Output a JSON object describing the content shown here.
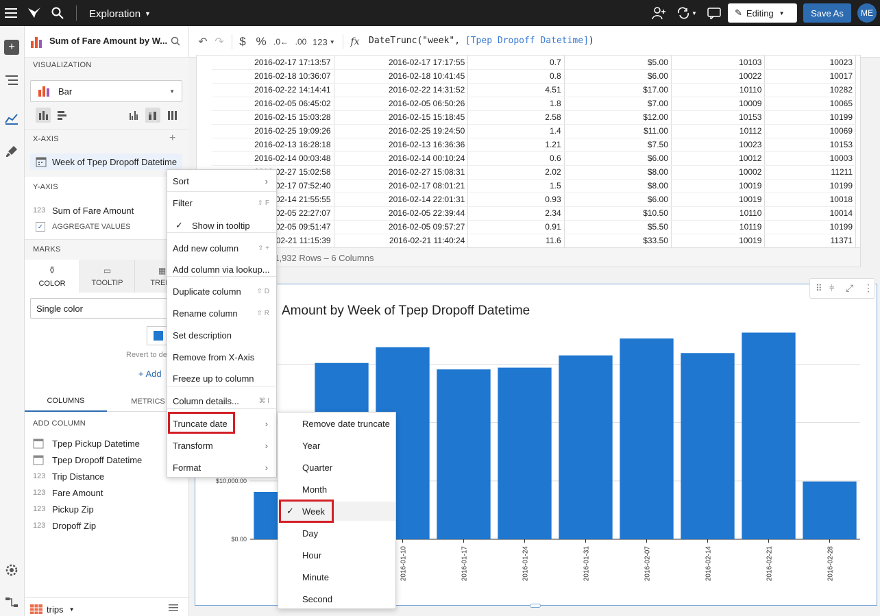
{
  "topbar": {
    "workbook_title": "Exploration",
    "editing_label": "Editing",
    "save_as_label": "Save As",
    "avatar_initials": "ME"
  },
  "panel": {
    "element_title": "Sum of Fare Amount by W...",
    "visualization_label": "VISUALIZATION",
    "chart_type": "Bar",
    "x_axis_label": "X-AXIS",
    "x_axis_field": "Week of Tpep Dropoff Datetime",
    "y_axis_label": "Y-AXIS",
    "y_axis_field_type": "123",
    "y_axis_field": "Sum of Fare Amount",
    "aggregate_label": "AGGREGATE VALUES",
    "marks_label": "MARKS",
    "marks_tabs": [
      "COLOR",
      "TOOLTIP",
      "TRELL"
    ],
    "color_mode": "Single color",
    "revert_label": "Revert to de",
    "add_label": "+ Add",
    "tabs": [
      "COLUMNS",
      "METRICS"
    ],
    "add_column_label": "ADD COLUMN",
    "columns": [
      {
        "type": "date",
        "name": "Tpep Pickup Datetime"
      },
      {
        "type": "date",
        "name": "Tpep Dropoff Datetime"
      },
      {
        "type": "123",
        "name": "Trip Distance"
      },
      {
        "type": "123",
        "name": "Fare Amount"
      },
      {
        "type": "123",
        "name": "Pickup Zip"
      },
      {
        "type": "123",
        "name": "Dropoff Zip"
      }
    ],
    "source_name": "trips"
  },
  "toolbar": {
    "format_dollar": "$",
    "format_percent": "%",
    "format_number": "123",
    "formula_prefix": "DateTrunc(\"week\", ",
    "formula_ref": "[Tpep Dropoff Datetime]",
    "formula_suffix": ")"
  },
  "table": {
    "rows": [
      [
        "2016-02-17 17:13:57",
        "2016-02-17 17:17:55",
        "0.7",
        "$5.00",
        "10103",
        "10023"
      ],
      [
        "2016-02-18 10:36:07",
        "2016-02-18 10:41:45",
        "0.8",
        "$6.00",
        "10022",
        "10017"
      ],
      [
        "2016-02-22 14:14:41",
        "2016-02-22 14:31:52",
        "4.51",
        "$17.00",
        "10110",
        "10282"
      ],
      [
        "2016-02-05 06:45:02",
        "2016-02-05 06:50:26",
        "1.8",
        "$7.00",
        "10009",
        "10065"
      ],
      [
        "2016-02-15 15:03:28",
        "2016-02-15 15:18:45",
        "2.58",
        "$12.00",
        "10153",
        "10199"
      ],
      [
        "2016-02-25 19:09:26",
        "2016-02-25 19:24:50",
        "1.4",
        "$11.00",
        "10112",
        "10069"
      ],
      [
        "2016-02-13 16:28:18",
        "2016-02-13 16:36:36",
        "1.21",
        "$7.50",
        "10023",
        "10153"
      ],
      [
        "2016-02-14 00:03:48",
        "2016-02-14 00:10:24",
        "0.6",
        "$6.00",
        "10012",
        "10003"
      ],
      [
        "2016-02-27 15:02:58",
        "2016-02-27 15:08:31",
        "2.02",
        "$8.00",
        "10002",
        "11211"
      ],
      [
        "2016-02-17 07:52:40",
        "2016-02-17 08:01:21",
        "1.5",
        "$8.00",
        "10019",
        "10199"
      ],
      [
        "2016-02-14 21:55:55",
        "2016-02-14 22:01:31",
        "0.93",
        "$6.00",
        "10019",
        "10018"
      ],
      [
        "2016-02-05 22:27:07",
        "2016-02-05 22:39:44",
        "2.34",
        "$10.50",
        "10110",
        "10014"
      ],
      [
        "2016-02-05 09:51:47",
        "2016-02-05 09:57:27",
        "0.91",
        "$5.50",
        "10119",
        "10199"
      ],
      [
        "2016-02-21 11:15:39",
        "2016-02-21 11:40:24",
        "11.6",
        "$33.50",
        "10019",
        "11371"
      ]
    ],
    "footer": "21,932 Rows – 6 Columns"
  },
  "context_menu": {
    "items": [
      {
        "label": "Sort",
        "shortcut": "",
        "submenu": true
      },
      {
        "label": "Filter",
        "shortcut": "⇧ F",
        "submenu": false
      },
      {
        "label": "Show in tooltip",
        "shortcut": "",
        "submenu": false,
        "checked": true
      },
      {
        "label": "Add new column",
        "shortcut": "⇧ +",
        "submenu": false
      },
      {
        "label": "Add column via lookup...",
        "shortcut": "",
        "submenu": false
      },
      {
        "label": "Duplicate column",
        "shortcut": "⇧ D",
        "submenu": false
      },
      {
        "label": "Rename column",
        "shortcut": "⇧ R",
        "submenu": false
      },
      {
        "label": "Set description",
        "shortcut": "",
        "submenu": false
      },
      {
        "label": "Remove from X-Axis",
        "shortcut": "",
        "submenu": false
      },
      {
        "label": "Freeze up to column",
        "shortcut": "",
        "submenu": false
      },
      {
        "label": "Column details...",
        "shortcut": "⌘ I",
        "submenu": false
      },
      {
        "label": "Truncate date",
        "shortcut": "",
        "submenu": true
      },
      {
        "label": "Transform",
        "shortcut": "",
        "submenu": true
      },
      {
        "label": "Format",
        "shortcut": "",
        "submenu": true
      }
    ]
  },
  "submenu": {
    "items": [
      "Remove date truncate",
      "Year",
      "Quarter",
      "Month",
      "Week",
      "Day",
      "Hour",
      "Minute",
      "Second"
    ],
    "checked": "Week"
  },
  "chart_data": {
    "type": "bar",
    "title": "Amount by Week of Tpep Dropoff Datetime",
    "categories": [
      "",
      "",
      "2016-01-10",
      "2016-01-17",
      "2016-01-24",
      "2016-01-31",
      "2016-02-07",
      "2016-02-14",
      "2016-02-21",
      "2016-02-28"
    ],
    "values": [
      8100,
      30200,
      32900,
      29100,
      29400,
      31500,
      34400,
      31900,
      35400,
      9900
    ],
    "y_ticks": [
      {
        "value": 0,
        "label": "$0.00"
      },
      {
        "value": 10000,
        "label": "$10,000.00"
      },
      {
        "value": 20000,
        "label": ""
      },
      {
        "value": 30000,
        "label": ""
      }
    ],
    "ylim": [
      0,
      37800
    ],
    "color": "#1f77d0",
    "grid": true
  }
}
